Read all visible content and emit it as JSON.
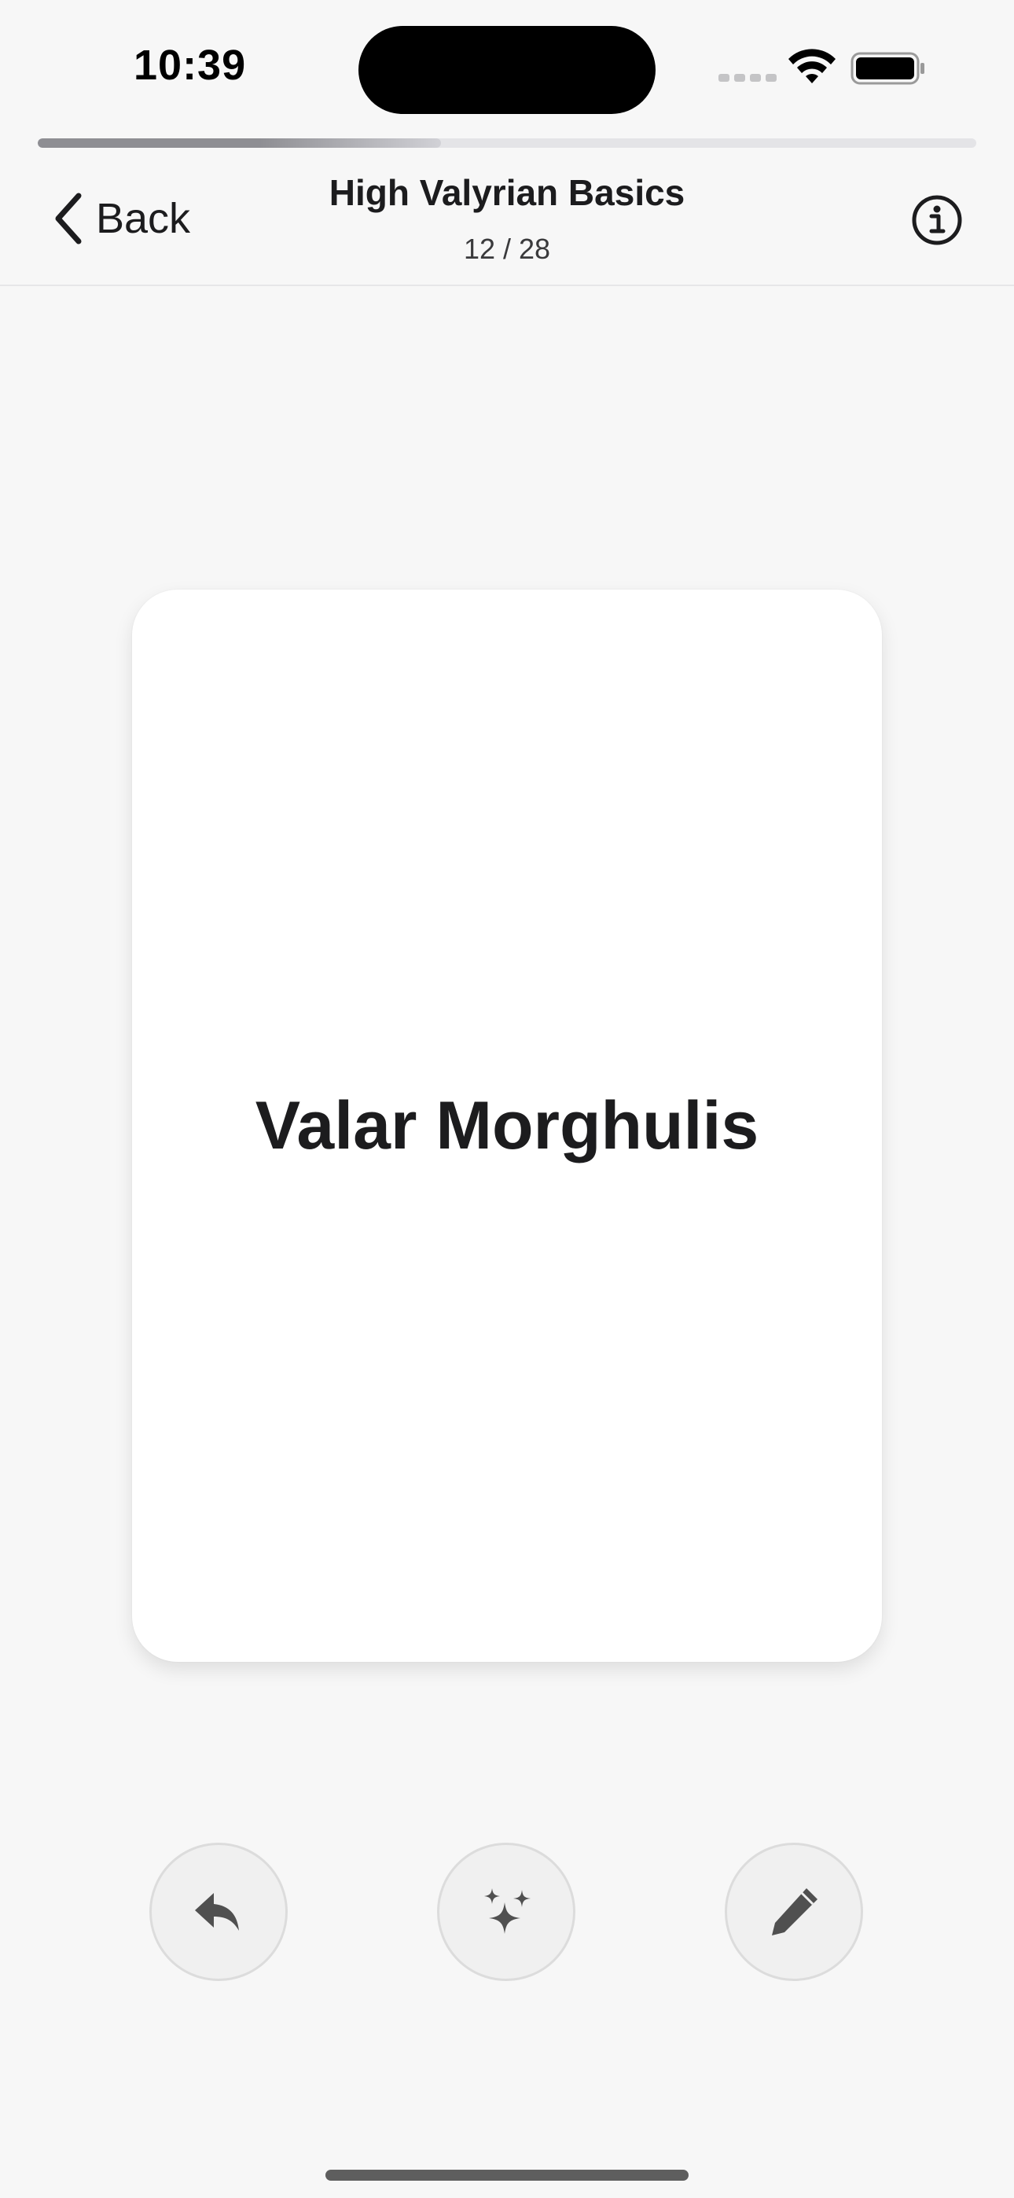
{
  "status_bar": {
    "time": "10:39",
    "icons": [
      "cellular-signal-icon",
      "wifi-icon",
      "battery-icon"
    ]
  },
  "progress": {
    "fraction": 0.43,
    "label": "12 / 28"
  },
  "nav": {
    "back_label": "Back",
    "title": "High Valyrian Basics",
    "subtitle": "12 / 28",
    "info_icon": "info-icon"
  },
  "card": {
    "front_text": "Valar Morghulis"
  },
  "actions": [
    {
      "name": "undo-button",
      "icon": "undo-arrow-icon"
    },
    {
      "name": "sparkle-button",
      "icon": "sparkles-icon"
    },
    {
      "name": "edit-button",
      "icon": "pencil-icon"
    }
  ],
  "colors": {
    "background": "#f7f7f7",
    "card": "#ffffff",
    "text": "#1c1c1e",
    "icon": "#505050",
    "progress_fill": "#8e8e93",
    "progress_track": "#e4e4e7"
  }
}
